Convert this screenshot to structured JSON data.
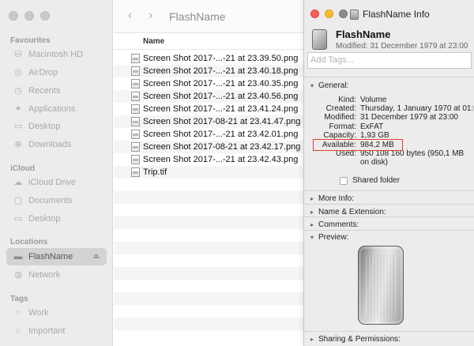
{
  "finder": {
    "title": "FlashName",
    "back_icon": "‹",
    "forward_icon": "›",
    "sidebar": {
      "favourites_label": "Favourites",
      "favourites": [
        {
          "label": "Macintosh HD",
          "icon": "⛁"
        },
        {
          "label": "AirDrop",
          "icon": "◎"
        },
        {
          "label": "Recents",
          "icon": "◷"
        },
        {
          "label": "Applications",
          "icon": "✦"
        },
        {
          "label": "Desktop",
          "icon": "▭"
        },
        {
          "label": "Downloads",
          "icon": "⊕"
        }
      ],
      "icloud_label": "iCloud",
      "icloud": [
        {
          "label": "iCloud Drive",
          "icon": "☁"
        },
        {
          "label": "Documents",
          "icon": "▢"
        },
        {
          "label": "Desktop",
          "icon": "▭"
        }
      ],
      "locations_label": "Locations",
      "locations": [
        {
          "label": "FlashName",
          "icon": "▬",
          "eject": "⏏"
        },
        {
          "label": "Network",
          "icon": "◍"
        }
      ],
      "tags_label": "Tags",
      "tags": [
        {
          "label": "Work",
          "icon": "○"
        },
        {
          "label": "Important",
          "icon": "○"
        }
      ]
    },
    "list": {
      "column_name": "Name",
      "files": [
        "Screen Shot 2017-...-21 at 23.39.50.png",
        "Screen Shot 2017-...-21 at 23.40.18.png",
        "Screen Shot 2017-...-21 at 23.40.35.png",
        "Screen Shot 2017-...-21 at 23.40.56.png",
        "Screen Shot 2017-...-21 at 23.41.24.png",
        "Screen Shot 2017-08-21 at 23.41.47.png",
        "Screen Shot 2017-...-21 at 23.42.01.png",
        "Screen Shot 2017-08-21 at 23.42.17.png",
        "Screen Shot 2017-...-21 at 23.42.43.png",
        "Trip.tif"
      ]
    }
  },
  "info": {
    "window_title": "FlashName Info",
    "name": "FlashName",
    "modified_summary": "Modified: 31 December 1979 at 23:00",
    "tags_placeholder": "Add Tags...",
    "general": {
      "heading": "General:",
      "kind_label": "Kind:",
      "kind": "Volume",
      "created_label": "Created:",
      "created": "Thursday, 1 January 1970 at 01:00",
      "modified_label": "Modified:",
      "modified": "31 December 1979 at 23:00",
      "format_label": "Format:",
      "format": "ExFAT",
      "capacity_label": "Capacity:",
      "capacity": "1,93 GB",
      "available_label": "Available:",
      "available": "984,2 MB",
      "used_label": "Used:",
      "used_line1": "950 108 160 bytes (950,1 MB",
      "used_line2": "on disk)",
      "shared_folder": "Shared folder"
    },
    "more_info": "More Info:",
    "name_extension": "Name & Extension:",
    "comments": "Comments:",
    "preview": "Preview:",
    "sharing": "Sharing & Permissions:",
    "highlight_color": "#e2402f"
  }
}
